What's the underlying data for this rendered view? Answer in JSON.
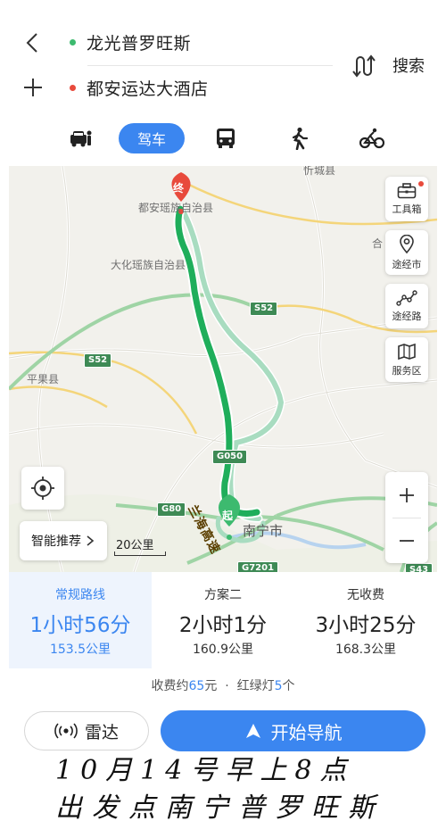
{
  "header": {
    "origin": "龙光普罗旺斯",
    "destination": "都安运达大酒店",
    "search_label": "搜索",
    "origin_color": "#3dba6f",
    "destination_color": "#e84a3c"
  },
  "modes": {
    "active_label": "驾车",
    "items": [
      "taxi-icon",
      "car",
      "bus-icon",
      "walk-icon",
      "bike-icon"
    ]
  },
  "map": {
    "labels": {
      "xincheng": "忻城县",
      "duan": "都安瑶族自治县",
      "dahua": "大化瑶族自治县",
      "pingguo": "平果县",
      "nanning": "南宁市",
      "he": "合"
    },
    "shields": {
      "s52a": "S52",
      "s52b": "S52",
      "g050": "G050",
      "g80": "G80",
      "g7201": "G7201",
      "s43": "S43"
    },
    "highway_name": "兰海高速",
    "end_marker": "终",
    "start_marker": "起",
    "tools": [
      {
        "name": "工具箱",
        "icon": "toolbox-icon"
      },
      {
        "name": "途经市",
        "icon": "location-pin-icon"
      },
      {
        "name": "途经路",
        "icon": "waypoints-icon"
      },
      {
        "name": "服务区",
        "icon": "map-fold-icon"
      }
    ],
    "smart_label": "智能推荐",
    "scale_label": "20公里",
    "route_color": "#1fae5b",
    "alt_route_color": "#a8dcc0"
  },
  "routes": [
    {
      "name": "常规路线",
      "time": "1小时56分",
      "distance": "153.5公里"
    },
    {
      "name": "方案二",
      "time": "2小时1分",
      "distance": "160.9公里"
    },
    {
      "name": "无收费",
      "time": "3小时25分",
      "distance": "168.3公里"
    }
  ],
  "summary": {
    "toll_prefix": "收费约",
    "toll_value": "65",
    "toll_suffix": "元",
    "sep": "·",
    "lights_prefix": "红绿灯",
    "lights_value": "5",
    "lights_suffix": "个"
  },
  "actions": {
    "radar": "雷达",
    "start_nav": "开始导航"
  },
  "handwriting": {
    "line1": "10月14号早上8点",
    "line2": "出发点南宁普罗旺斯"
  }
}
